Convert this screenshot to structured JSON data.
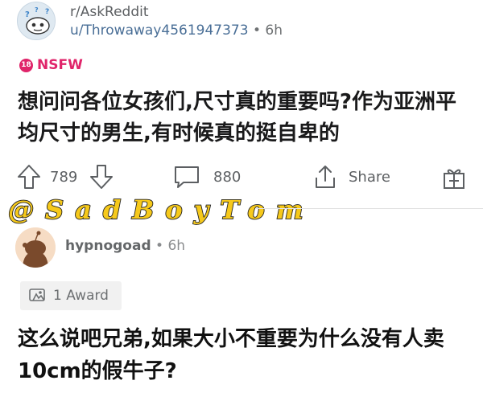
{
  "post": {
    "subreddit": "r/AskReddit",
    "username": "u/Throwaway4561947373",
    "separator": "•",
    "time": "6h",
    "nsfw_badge": "18",
    "nsfw_label": "NSFW",
    "title": "想问问各位女孩们,尺寸真的重要吗?作为亚洲平均尺寸的男生,有时候真的挺自卑的"
  },
  "actions": {
    "upvotes": "789",
    "comments": "880",
    "share": "Share"
  },
  "watermark": "@SadBoyTom",
  "comment": {
    "author": "hypnogoad",
    "separator": "•",
    "time": "6h",
    "award_label": "1 Award",
    "body": "这么说吧兄弟,如果大小不重要为什么没有人卖10cm的假牛子?"
  },
  "colors": {
    "nsfw": "#e0246a",
    "username_link": "#4a6f97",
    "watermark_fill": "#f6c91b",
    "watermark_outline": "#222222"
  },
  "icons": [
    "subreddit-avatar-icon",
    "nsfw-18-icon",
    "upvote-arrow-icon",
    "downvote-arrow-icon",
    "comment-bubble-icon",
    "share-icon",
    "gift-award-icon",
    "award-icon",
    "snoo-avatar-icon"
  ]
}
